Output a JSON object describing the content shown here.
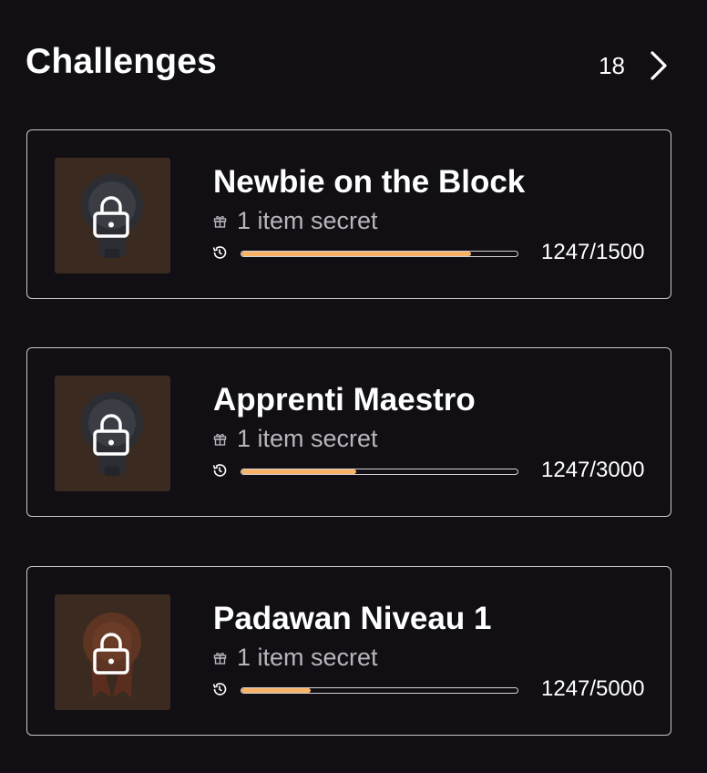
{
  "header": {
    "title": "Challenges",
    "count": "18"
  },
  "challenges": [
    {
      "name": "Newbie on the Block",
      "secret": "1 item secret",
      "progress_text": "1247/1500",
      "progress_fraction": 0.8313,
      "badge_icon": "microphone-badge-icon"
    },
    {
      "name": "Apprenti Maestro",
      "secret": "1 item secret",
      "progress_text": "1247/3000",
      "progress_fraction": 0.4157,
      "badge_icon": "microphone-badge-icon"
    },
    {
      "name": "Padawan Niveau 1",
      "secret": "1 item secret",
      "progress_text": "1247/5000",
      "progress_fraction": 0.2494,
      "badge_icon": "medal-badge-icon"
    }
  ],
  "colors": {
    "background": "#110e14",
    "progress_fill": "#f8b367",
    "thumb_bg": "#3a2a1f"
  }
}
